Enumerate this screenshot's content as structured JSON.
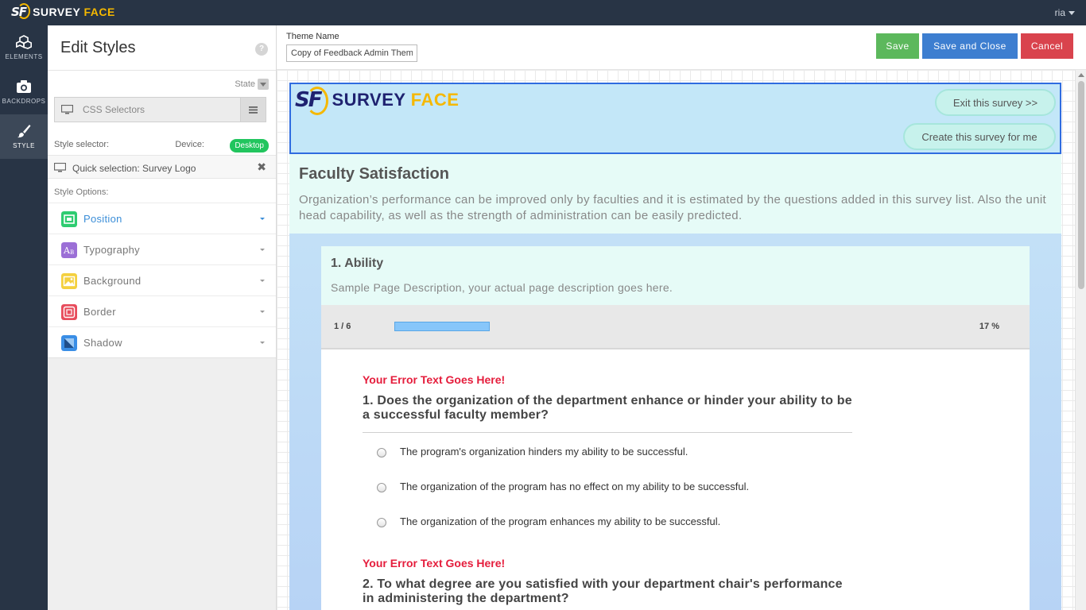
{
  "topbar": {
    "logo_mark": "SF",
    "logo_text": "SURVEY ",
    "logo_accent": "FACE",
    "user": "ria"
  },
  "rail": {
    "items": [
      {
        "label": "ELEMENTS",
        "icon": "cubes-icon"
      },
      {
        "label": "BACKDROPS",
        "icon": "camera-icon"
      },
      {
        "label": "STYLE",
        "icon": "brush-icon"
      }
    ],
    "active": "STYLE"
  },
  "panel": {
    "title": "Edit Styles",
    "help": "?",
    "state_label": "State",
    "css_selectors_placeholder": "CSS Selectors",
    "style_selector_label": "Style selector:",
    "device_label": "Device:",
    "device_value": "Desktop",
    "quick_selection": "Quick selection: Survey Logo",
    "close_glyph": "✖",
    "style_options_label": "Style Options:",
    "options": [
      {
        "label": "Position",
        "icon": "position-icon",
        "color": "#2ecc71",
        "active": true
      },
      {
        "label": "Typography",
        "icon": "typography-icon",
        "color": "#9b6fd6",
        "active": false
      },
      {
        "label": "Background",
        "icon": "background-icon",
        "color": "#f4d03f",
        "active": false
      },
      {
        "label": "Border",
        "icon": "border-icon",
        "color": "#e74c5c",
        "active": false
      },
      {
        "label": "Shadow",
        "icon": "shadow-icon",
        "color": "#3a8ee6",
        "active": false
      }
    ]
  },
  "theme": {
    "label": "Theme Name",
    "value": "Copy of Feedback Admin Theme"
  },
  "buttons": {
    "save": "Save",
    "save_close": "Save and Close",
    "cancel": "Cancel"
  },
  "survey": {
    "logo_mark": "SF",
    "logo_name": "SURVEY ",
    "logo_accent": "FACE",
    "exit_button": "Exit this survey >>",
    "create_button": "Create this survey for me",
    "title": "Faculty Satisfaction",
    "description": "Organization’s performance can be improved only by faculties and it is estimated by the questions added in this survey list. Also the unit head capability, as well as the strength of administration can be easily predicted.",
    "page": {
      "title": "1. Ability",
      "description": "Sample Page Description, your actual page description goes here.",
      "progress_count": "1 / 6",
      "progress_percent": "17 %",
      "progress_fraction": 0.17
    },
    "questions": [
      {
        "error": "Your Error Text Goes Here!",
        "text": "1. Does the organization of the department enhance or hinder your ability to be a successful faculty member?",
        "options": [
          "The program's organization hinders my ability to be successful.",
          "The organization of the program has no effect on my ability to be successful.",
          "The organization of the program enhances my ability to be successful."
        ]
      },
      {
        "error": "Your Error Text Goes Here!",
        "text": "2. To what degree are you satisfied with your department chair's performance in administering the department?"
      }
    ]
  },
  "colors": {
    "topbar": "#283445",
    "selection_outline": "#2f6ce0",
    "error": "#e51d3c",
    "save": "#5cb85c",
    "save_close": "#3d7ed0",
    "cancel": "#d9434d"
  }
}
